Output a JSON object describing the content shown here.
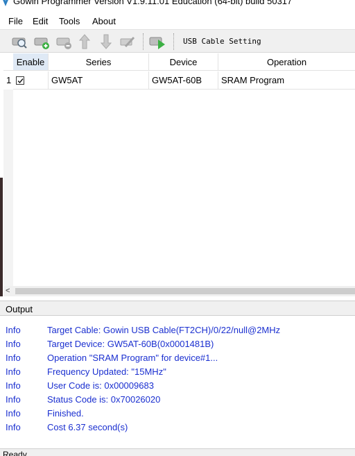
{
  "window": {
    "title": "Gowin Programmer Version V1.9.11.01 Education (64-bit) build 50317"
  },
  "menu": {
    "items": [
      "File",
      "Edit",
      "Tools",
      "About"
    ]
  },
  "toolbar": {
    "buttons": [
      "scan-device",
      "add-device",
      "remove-device",
      "move-up",
      "move-down",
      "edit-config",
      "program-run"
    ],
    "usb_cable_label": "USB Cable Setting"
  },
  "table": {
    "headers": [
      "Enable",
      "Series",
      "Device",
      "Operation"
    ],
    "rows": [
      {
        "index": "1",
        "enabled": true,
        "series": "GW5AT",
        "device": "GW5AT-60B",
        "operation": "SRAM Program"
      }
    ]
  },
  "output": {
    "title": "Output",
    "entries": [
      {
        "level": "Info",
        "message": "Target Cable: Gowin USB Cable(FT2CH)/0/22/null@2MHz"
      },
      {
        "level": "Info",
        "message": "Target Device: GW5AT-60B(0x0001481B)"
      },
      {
        "level": "Info",
        "message": "Operation \"SRAM Program\" for device#1..."
      },
      {
        "level": "Info",
        "message": "Frequency Updated: \"15MHz\""
      },
      {
        "level": "Info",
        "message": "User Code is: 0x00009683"
      },
      {
        "level": "Info",
        "message": "Status Code is: 0x70026020"
      },
      {
        "level": "Info",
        "message": "Finished."
      },
      {
        "level": "Info",
        "message": "Cost 6.37 second(s)"
      }
    ]
  },
  "status": {
    "text": "Ready"
  },
  "colors": {
    "log_text": "#1a2fd0",
    "enable_header_bg": "#dfe9f5",
    "program_green": "#3cb043"
  }
}
